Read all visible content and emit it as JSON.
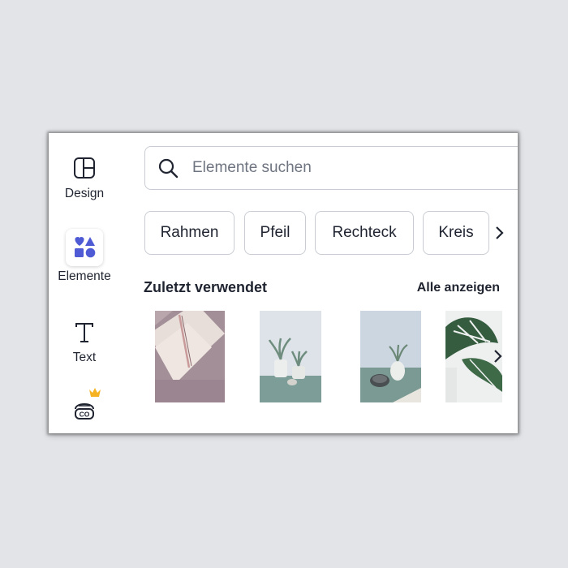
{
  "sidebar": {
    "items": [
      {
        "label": "Design",
        "icon": "layout-icon"
      },
      {
        "label": "Elemente",
        "icon": "shapes-icon",
        "active": true,
        "accent": "#4f5bd5"
      },
      {
        "label": "Text",
        "icon": "text-icon"
      },
      {
        "label": "",
        "icon": "brand-kit-icon",
        "premium": true,
        "premium_color": "#f5b324"
      }
    ]
  },
  "search": {
    "placeholder": "Elemente suchen",
    "value": "",
    "icon": "search-icon"
  },
  "chips": [
    {
      "label": "Rahmen"
    },
    {
      "label": "Pfeil"
    },
    {
      "label": "Rechteck"
    },
    {
      "label": "Kreis"
    }
  ],
  "recent": {
    "title": "Zuletzt verwendet",
    "see_all": "Alle anzeigen",
    "images": [
      {
        "name": "notebook-and-pen-photo"
      },
      {
        "name": "two-succulents-photo"
      },
      {
        "name": "plant-vase-photo"
      },
      {
        "name": "monstera-leaf-photo"
      }
    ]
  }
}
